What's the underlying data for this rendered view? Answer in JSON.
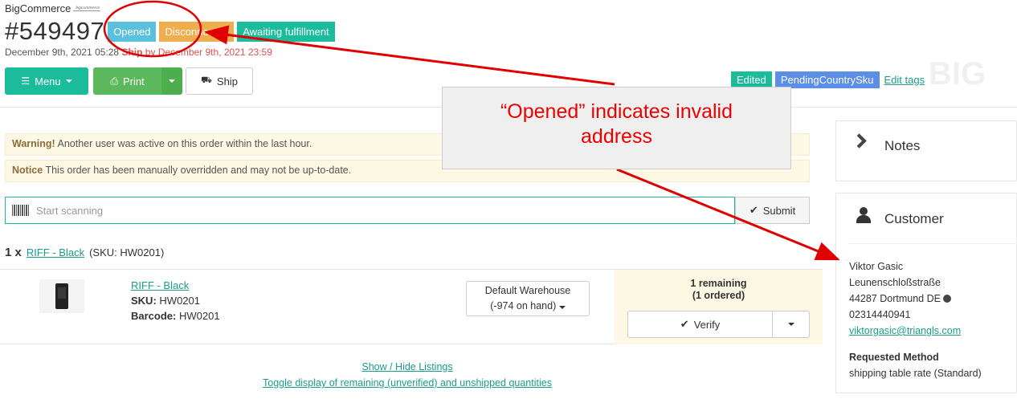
{
  "header": {
    "brand": "BigCommerce",
    "order_number": "#549497",
    "badges": {
      "opened": "Opened",
      "disconnected": "Disconnected",
      "awaiting": "Awaiting fulfillment"
    },
    "date_text": "December 9th, 2021 05:28",
    "ship_label": "Ship",
    "ship_by": "by December 9th, 2021 23:59",
    "menu_label": "Menu",
    "print_label": "Print",
    "ship_button": "Ship",
    "tags": {
      "edited": "Edited",
      "pending": "PendingCountrySku",
      "edit_link": "Edit tags"
    },
    "watermark": "BIG"
  },
  "alerts": {
    "warning_bold": "Warning!",
    "warning_text": "Another user was active on this order within the last hour.",
    "notice_bold": "Notice",
    "notice_text": "This order has been manually overridden and may not be up-to-date."
  },
  "scan": {
    "placeholder": "Start scanning",
    "submit": "Submit"
  },
  "item": {
    "qty": "1 x",
    "title_link": "RIFF - Black",
    "sku_inline": "(SKU: HW0201)",
    "name": "RIFF - Black",
    "sku_label": "SKU:",
    "sku": "HW0201",
    "barcode_label": "Barcode:",
    "barcode": "HW0201",
    "warehouse_line1": "Default Warehouse",
    "warehouse_line2": "(-974 on hand)",
    "remaining": "1 remaining",
    "ordered": "(1 ordered)",
    "verify": "Verify"
  },
  "links": {
    "show_hide": "Show / Hide Listings",
    "toggle": "Toggle display of remaining (unverified) and unshipped quantities"
  },
  "sidebar": {
    "notes_title": "Notes",
    "customer_title": "Customer",
    "name": "Viktor Gasic",
    "street": "Leunenschloßstraße",
    "city": "44287 Dortmund DE",
    "phone": "02314440941",
    "email": "viktorgasic@triangls.com",
    "req_method_title": "Requested Method",
    "req_method": "shipping table rate (Standard)"
  },
  "annotation": {
    "line1": "“Opened” indicates invalid",
    "line2": "address",
    "color": "#e00000"
  }
}
